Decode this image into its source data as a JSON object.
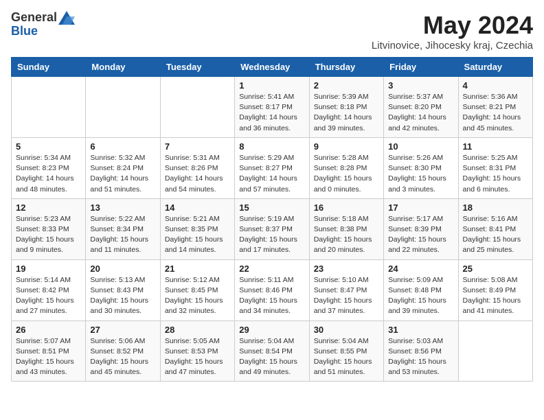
{
  "logo": {
    "general": "General",
    "blue": "Blue"
  },
  "title": "May 2024",
  "subtitle": "Litvinovice, Jihocesky kraj, Czechia",
  "days_of_week": [
    "Sunday",
    "Monday",
    "Tuesday",
    "Wednesday",
    "Thursday",
    "Friday",
    "Saturday"
  ],
  "weeks": [
    [
      {
        "day": "",
        "info": ""
      },
      {
        "day": "",
        "info": ""
      },
      {
        "day": "",
        "info": ""
      },
      {
        "day": "1",
        "info": "Sunrise: 5:41 AM\nSunset: 8:17 PM\nDaylight: 14 hours and 36 minutes."
      },
      {
        "day": "2",
        "info": "Sunrise: 5:39 AM\nSunset: 8:18 PM\nDaylight: 14 hours and 39 minutes."
      },
      {
        "day": "3",
        "info": "Sunrise: 5:37 AM\nSunset: 8:20 PM\nDaylight: 14 hours and 42 minutes."
      },
      {
        "day": "4",
        "info": "Sunrise: 5:36 AM\nSunset: 8:21 PM\nDaylight: 14 hours and 45 minutes."
      }
    ],
    [
      {
        "day": "5",
        "info": "Sunrise: 5:34 AM\nSunset: 8:23 PM\nDaylight: 14 hours and 48 minutes."
      },
      {
        "day": "6",
        "info": "Sunrise: 5:32 AM\nSunset: 8:24 PM\nDaylight: 14 hours and 51 minutes."
      },
      {
        "day": "7",
        "info": "Sunrise: 5:31 AM\nSunset: 8:26 PM\nDaylight: 14 hours and 54 minutes."
      },
      {
        "day": "8",
        "info": "Sunrise: 5:29 AM\nSunset: 8:27 PM\nDaylight: 14 hours and 57 minutes."
      },
      {
        "day": "9",
        "info": "Sunrise: 5:28 AM\nSunset: 8:28 PM\nDaylight: 15 hours and 0 minutes."
      },
      {
        "day": "10",
        "info": "Sunrise: 5:26 AM\nSunset: 8:30 PM\nDaylight: 15 hours and 3 minutes."
      },
      {
        "day": "11",
        "info": "Sunrise: 5:25 AM\nSunset: 8:31 PM\nDaylight: 15 hours and 6 minutes."
      }
    ],
    [
      {
        "day": "12",
        "info": "Sunrise: 5:23 AM\nSunset: 8:33 PM\nDaylight: 15 hours and 9 minutes."
      },
      {
        "day": "13",
        "info": "Sunrise: 5:22 AM\nSunset: 8:34 PM\nDaylight: 15 hours and 11 minutes."
      },
      {
        "day": "14",
        "info": "Sunrise: 5:21 AM\nSunset: 8:35 PM\nDaylight: 15 hours and 14 minutes."
      },
      {
        "day": "15",
        "info": "Sunrise: 5:19 AM\nSunset: 8:37 PM\nDaylight: 15 hours and 17 minutes."
      },
      {
        "day": "16",
        "info": "Sunrise: 5:18 AM\nSunset: 8:38 PM\nDaylight: 15 hours and 20 minutes."
      },
      {
        "day": "17",
        "info": "Sunrise: 5:17 AM\nSunset: 8:39 PM\nDaylight: 15 hours and 22 minutes."
      },
      {
        "day": "18",
        "info": "Sunrise: 5:16 AM\nSunset: 8:41 PM\nDaylight: 15 hours and 25 minutes."
      }
    ],
    [
      {
        "day": "19",
        "info": "Sunrise: 5:14 AM\nSunset: 8:42 PM\nDaylight: 15 hours and 27 minutes."
      },
      {
        "day": "20",
        "info": "Sunrise: 5:13 AM\nSunset: 8:43 PM\nDaylight: 15 hours and 30 minutes."
      },
      {
        "day": "21",
        "info": "Sunrise: 5:12 AM\nSunset: 8:45 PM\nDaylight: 15 hours and 32 minutes."
      },
      {
        "day": "22",
        "info": "Sunrise: 5:11 AM\nSunset: 8:46 PM\nDaylight: 15 hours and 34 minutes."
      },
      {
        "day": "23",
        "info": "Sunrise: 5:10 AM\nSunset: 8:47 PM\nDaylight: 15 hours and 37 minutes."
      },
      {
        "day": "24",
        "info": "Sunrise: 5:09 AM\nSunset: 8:48 PM\nDaylight: 15 hours and 39 minutes."
      },
      {
        "day": "25",
        "info": "Sunrise: 5:08 AM\nSunset: 8:49 PM\nDaylight: 15 hours and 41 minutes."
      }
    ],
    [
      {
        "day": "26",
        "info": "Sunrise: 5:07 AM\nSunset: 8:51 PM\nDaylight: 15 hours and 43 minutes."
      },
      {
        "day": "27",
        "info": "Sunrise: 5:06 AM\nSunset: 8:52 PM\nDaylight: 15 hours and 45 minutes."
      },
      {
        "day": "28",
        "info": "Sunrise: 5:05 AM\nSunset: 8:53 PM\nDaylight: 15 hours and 47 minutes."
      },
      {
        "day": "29",
        "info": "Sunrise: 5:04 AM\nSunset: 8:54 PM\nDaylight: 15 hours and 49 minutes."
      },
      {
        "day": "30",
        "info": "Sunrise: 5:04 AM\nSunset: 8:55 PM\nDaylight: 15 hours and 51 minutes."
      },
      {
        "day": "31",
        "info": "Sunrise: 5:03 AM\nSunset: 8:56 PM\nDaylight: 15 hours and 53 minutes."
      },
      {
        "day": "",
        "info": ""
      }
    ]
  ]
}
